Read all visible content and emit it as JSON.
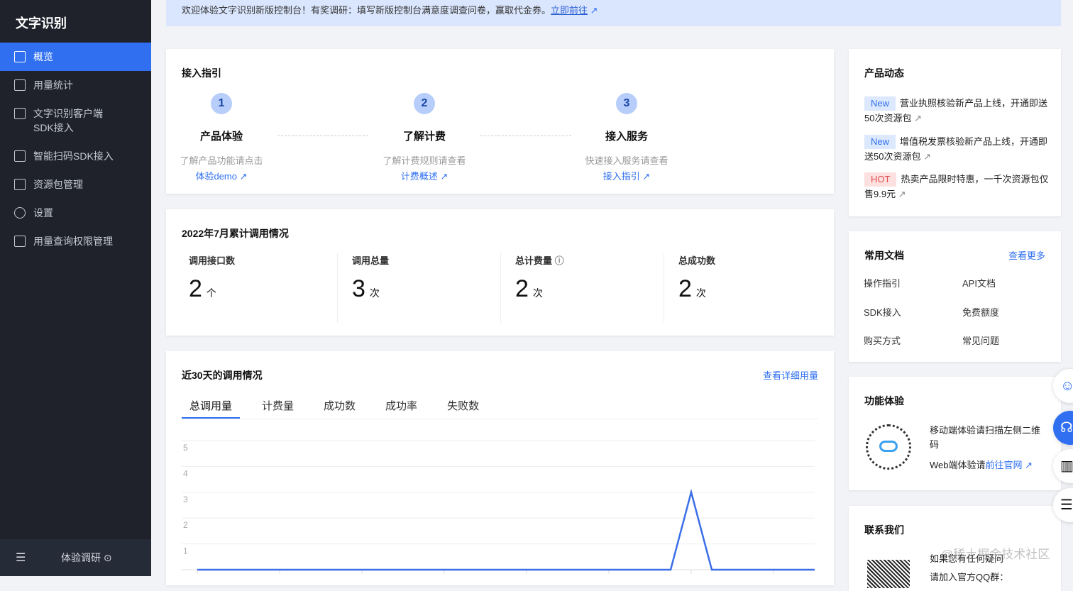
{
  "sidebar": {
    "title": "文字识别",
    "items": [
      {
        "label": "概览",
        "icon": "grid-icon",
        "active": true
      },
      {
        "label": "用量统计",
        "icon": "bar-chart-icon"
      },
      {
        "label": "文字识别客户端\nSDK接入",
        "icon": "text-box-icon"
      },
      {
        "label": "智能扫码SDK接入",
        "icon": "scan-icon"
      },
      {
        "label": "资源包管理",
        "icon": "package-icon"
      },
      {
        "label": "设置",
        "icon": "hexagon-gear-icon"
      },
      {
        "label": "用量查询权限管理",
        "icon": "sliders-icon"
      }
    ],
    "footer": {
      "label": "体验调研"
    }
  },
  "banner": {
    "text": "欢迎体验文字识别新版控制台！有奖调研：填写新版控制台满意度调查问卷，赢取代金券。",
    "link": "立即前往"
  },
  "guide": {
    "title": "接入指引",
    "steps": [
      {
        "num": "1",
        "title": "产品体验",
        "desc": "了解产品功能请点击",
        "link": "体验demo"
      },
      {
        "num": "2",
        "title": "了解计费",
        "desc": "了解计费规则请查看",
        "link": "计费概述"
      },
      {
        "num": "3",
        "title": "接入服务",
        "desc": "快速接入服务请查看",
        "link": "接入指引"
      }
    ]
  },
  "stats": {
    "title": "2022年7月累计调用情况",
    "items": [
      {
        "label": "调用接口数",
        "value": "2",
        "unit": "个"
      },
      {
        "label": "调用总量",
        "value": "3",
        "unit": "次"
      },
      {
        "label": "总计费量",
        "value": "2",
        "unit": "次"
      },
      {
        "label": "总成功数",
        "value": "2",
        "unit": "次"
      }
    ]
  },
  "usage": {
    "title": "近30天的调用情况",
    "more": "查看详细用量",
    "tabs": [
      "总调用量",
      "计费量",
      "成功数",
      "成功率",
      "失败数"
    ]
  },
  "chart_data": {
    "type": "line",
    "ylim": [
      0,
      5
    ],
    "yticks": [
      "1",
      "2",
      "3",
      "4",
      "5"
    ],
    "values": [
      0,
      0,
      0,
      0,
      0,
      0,
      0,
      0,
      0,
      0,
      0,
      0,
      0,
      0,
      0,
      0,
      0,
      0,
      0,
      0,
      0,
      0,
      0,
      0,
      3,
      0,
      0,
      0,
      0,
      0,
      0
    ],
    "color": "#3a6ee8",
    "grid": true
  },
  "news": {
    "title": "产品动态",
    "items": [
      {
        "badge": "New",
        "text": "营业执照核验新产品上线，开通即送50次资源包"
      },
      {
        "badge": "New",
        "text": "增值税发票核验新产品上线，开通即送50次资源包"
      },
      {
        "badge": "HOT",
        "text": "热卖产品限时特惠，一千次资源包仅售9.9元"
      }
    ]
  },
  "docs": {
    "title": "常用文档",
    "more": "查看更多",
    "items": [
      "操作指引",
      "API文档",
      "SDK接入",
      "免费额度",
      "购买方式",
      "常见问题"
    ]
  },
  "trial": {
    "title": "功能体验",
    "mobile": "移动端体验请扫描左侧二维码",
    "web_prefix": "Web端体验请",
    "web_link": "前往官网"
  },
  "contact": {
    "title": "联系我们",
    "line1": "如果您有任何疑问",
    "line2": "请加入官方QQ群："
  },
  "watermark": "@稀土掘金技术社区"
}
